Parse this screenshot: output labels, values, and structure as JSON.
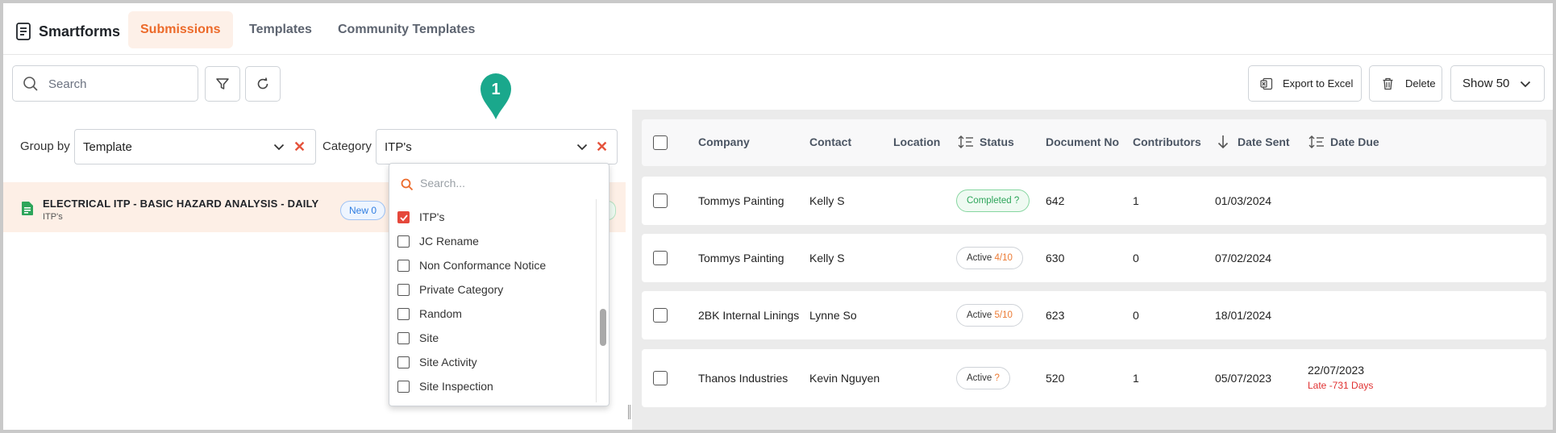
{
  "app": {
    "title": "Smartforms"
  },
  "nav": {
    "tabs": [
      {
        "label": "Submissions",
        "active": true
      },
      {
        "label": "Templates",
        "active": false
      },
      {
        "label": "Community Templates",
        "active": false
      }
    ]
  },
  "toolbar": {
    "search_placeholder": "Search",
    "export_label": "Export to Excel",
    "delete_label": "Delete",
    "show_label": "Show 50"
  },
  "filters": {
    "group_by_label": "Group by",
    "group_by_value": "Template",
    "category_label": "Category",
    "category_value": "ITP's"
  },
  "dropdown": {
    "search_placeholder": "Search...",
    "options": [
      {
        "label": "ITP's",
        "checked": true
      },
      {
        "label": "JC Rename",
        "checked": false
      },
      {
        "label": "Non Conformance Notice",
        "checked": false
      },
      {
        "label": "Private Category",
        "checked": false
      },
      {
        "label": "Random",
        "checked": false
      },
      {
        "label": "Site",
        "checked": false
      },
      {
        "label": "Site Activity",
        "checked": false
      },
      {
        "label": "Site Inspection",
        "checked": false
      }
    ]
  },
  "group": {
    "title": "ELECTRICAL ITP - BASIC HAZARD ANALYSIS - DAILY",
    "subtitle": "ITP's",
    "new_badge": "New 0"
  },
  "marker": {
    "number": "1",
    "color": "#1aa88c"
  },
  "table": {
    "columns": {
      "company": "Company",
      "contact": "Contact",
      "location": "Location",
      "status": "Status",
      "document_no": "Document No",
      "contributors": "Contributors",
      "date_sent": "Date Sent",
      "date_due": "Date Due"
    },
    "rows": [
      {
        "company": "Tommys Painting",
        "contact": "Kelly S",
        "location": "",
        "status_text": "Completed",
        "status_count": "?",
        "document_no": "642",
        "contributors": "1",
        "date_sent": "01/03/2024",
        "date_due": "",
        "late": ""
      },
      {
        "company": "Tommys Painting",
        "contact": "Kelly S",
        "location": "",
        "status_text": "Active",
        "status_count": "4/10",
        "document_no": "630",
        "contributors": "0",
        "date_sent": "07/02/2024",
        "date_due": "",
        "late": ""
      },
      {
        "company": "2BK Internal Linings",
        "contact": "Lynne So",
        "location": "",
        "status_text": "Active",
        "status_count": "5/10",
        "document_no": "623",
        "contributors": "0",
        "date_sent": "18/01/2024",
        "date_due": "",
        "late": ""
      },
      {
        "company": "Thanos Industries",
        "contact": "Kevin Nguyen",
        "location": "",
        "status_text": "Active",
        "status_count": "?",
        "document_no": "520",
        "contributors": "1",
        "date_sent": "05/07/2023",
        "date_due": "22/07/2023",
        "late": "Late -731 Days"
      }
    ]
  },
  "colors": {
    "accent": "#ec6a2a",
    "completed": "#2da55a",
    "late": "#e03131",
    "checkbox_checked": "#e5483b"
  }
}
